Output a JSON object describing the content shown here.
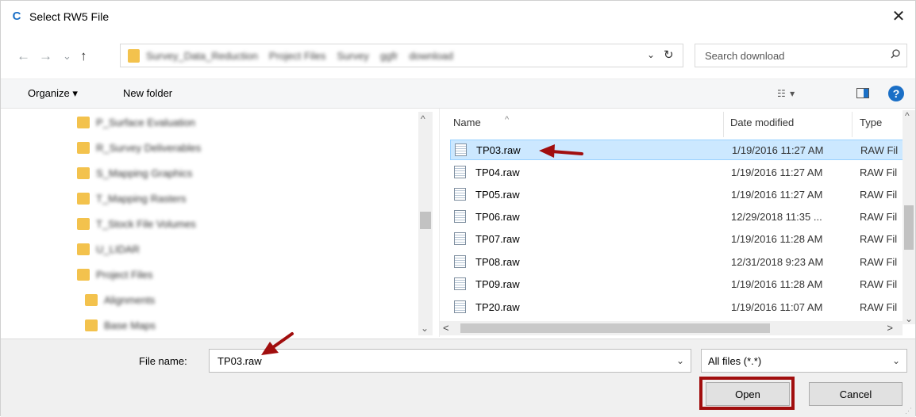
{
  "window": {
    "title": "Select RW5 File",
    "app_icon_glyph": "C",
    "close_glyph": "✕"
  },
  "nav": {
    "back_glyph": "←",
    "forward_glyph": "→",
    "recent_glyph": "⌄",
    "up_glyph": "↑",
    "breadcrumbs": [
      "Survey_Data_Reduction",
      "Project Files",
      "Survey",
      "ggfr",
      "download"
    ],
    "dropdown_glyph": "⌄",
    "refresh_glyph": "↻"
  },
  "search": {
    "placeholder": "Search download"
  },
  "toolbar": {
    "organize_label": "Organize ▾",
    "new_folder_label": "New folder",
    "views_glyph": "☷ ▾",
    "help_glyph": "?"
  },
  "tree": {
    "items": [
      {
        "label": "P_Surface Evaluation",
        "indent": 0
      },
      {
        "label": "R_Survey Deliverables",
        "indent": 0
      },
      {
        "label": "S_Mapping Graphics",
        "indent": 0
      },
      {
        "label": "T_Mapping Rasters",
        "indent": 0
      },
      {
        "label": "T_Stock File Volumes",
        "indent": 0
      },
      {
        "label": "U_LIDAR",
        "indent": 0
      },
      {
        "label": "Project Files",
        "indent": 0
      },
      {
        "label": "Alignments",
        "indent": 1
      },
      {
        "label": "Base Maps",
        "indent": 1
      }
    ],
    "scroll_up_glyph": "^",
    "scroll_down_glyph": "⌄"
  },
  "filelist": {
    "columns": {
      "name": "Name",
      "date": "Date modified",
      "type": "Type"
    },
    "sort_glyph": "^",
    "rows": [
      {
        "name": "TP03.raw",
        "date": "1/19/2016 11:27 AM",
        "type": "RAW Fil",
        "selected": true
      },
      {
        "name": "TP04.raw",
        "date": "1/19/2016 11:27 AM",
        "type": "RAW Fil",
        "selected": false
      },
      {
        "name": "TP05.raw",
        "date": "1/19/2016 11:27 AM",
        "type": "RAW Fil",
        "selected": false
      },
      {
        "name": "TP06.raw",
        "date": "12/29/2018 11:35 ...",
        "type": "RAW Fil",
        "selected": false
      },
      {
        "name": "TP07.raw",
        "date": "1/19/2016 11:28 AM",
        "type": "RAW Fil",
        "selected": false
      },
      {
        "name": "TP08.raw",
        "date": "12/31/2018 9:23 AM",
        "type": "RAW Fil",
        "selected": false
      },
      {
        "name": "TP09.raw",
        "date": "1/19/2016 11:28 AM",
        "type": "RAW Fil",
        "selected": false
      },
      {
        "name": "TP20.raw",
        "date": "1/19/2016 11:07 AM",
        "type": "RAW Fil",
        "selected": false
      }
    ],
    "h_left_glyph": "<",
    "h_right_glyph": ">",
    "v_up_glyph": "^",
    "v_down_glyph": "⌄"
  },
  "bottom": {
    "file_name_label": "File name:",
    "file_name_value": "TP03.raw",
    "filter_value": "All files (*.*)",
    "dropdown_glyph": "⌄",
    "open_label": "Open",
    "cancel_label": "Cancel"
  },
  "colors": {
    "accent": "#1a6fc6",
    "selection": "#cce8ff",
    "annotation_red": "#a10e0e",
    "folder": "#f3c24d"
  }
}
